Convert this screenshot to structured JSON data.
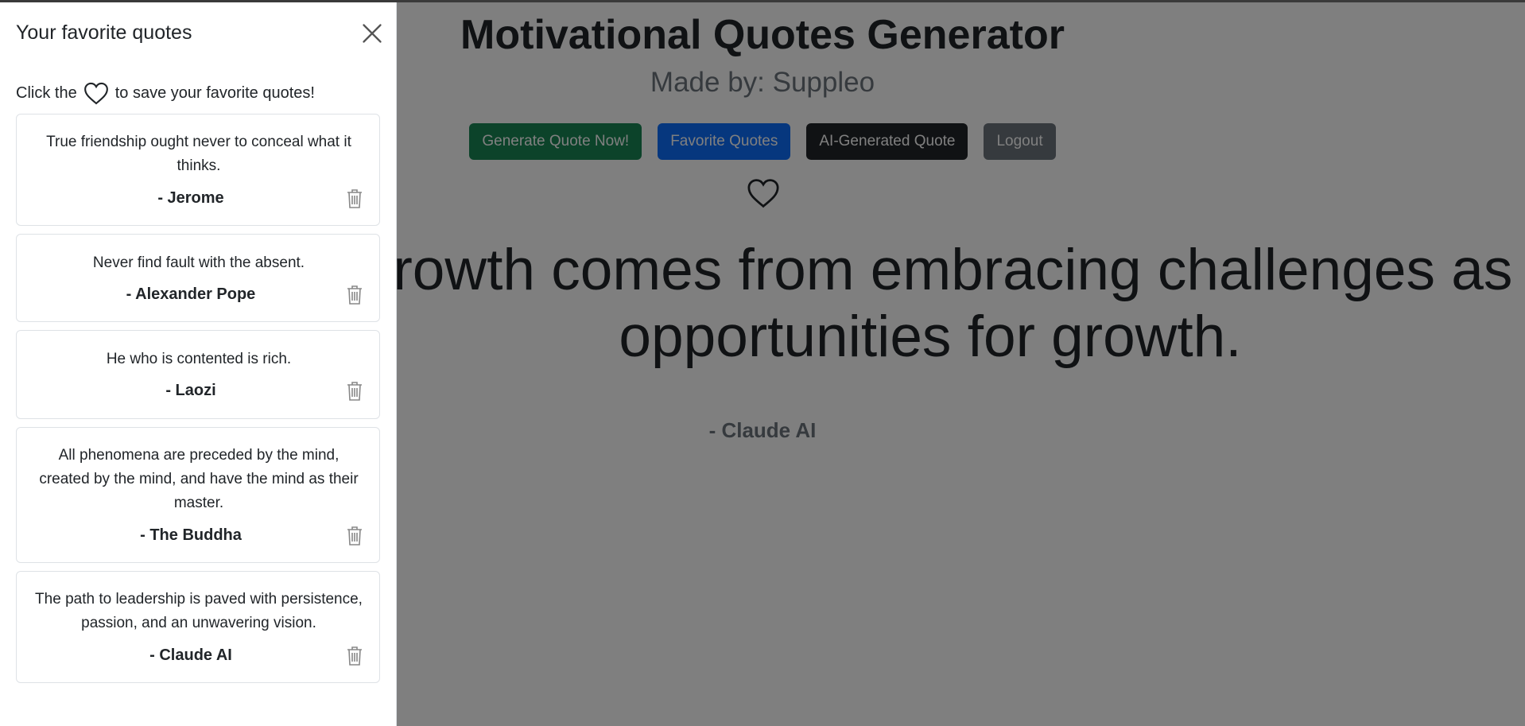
{
  "main": {
    "title": "Motivational Quotes Generator",
    "subtitle": "Made by: Suppleo",
    "buttons": {
      "generate": "Generate Quote Now!",
      "favorites": "Favorite Quotes",
      "ai": "AI-Generated Quote",
      "logout": "Logout"
    },
    "quote_line1": "Growth comes from embracing challenges as",
    "quote_line2": "opportunities for growth.",
    "quote_author": "- Claude AI"
  },
  "offcanvas": {
    "title": "Your favorite quotes",
    "hint_before": "Click the",
    "hint_after": "to save your favorite quotes!",
    "favorites": [
      {
        "text": "True friendship ought never to conceal what it thinks.",
        "author": "- Jerome"
      },
      {
        "text": "Never find fault with the absent.",
        "author": "- Alexander Pope"
      },
      {
        "text": "He who is contented is rich.",
        "author": "- Laozi"
      },
      {
        "text": "All phenomena are preceded by the mind, created by the mind, and have the mind as their master.",
        "author": "- The Buddha"
      },
      {
        "text": "The path to leadership is paved with persistence, passion, and an unwavering vision.",
        "author": "- Claude AI"
      }
    ]
  },
  "colors": {
    "green": "#198754",
    "blue": "#0d6efd",
    "dark": "#212529",
    "gray": "#6c757d",
    "backdrop": "rgba(0,0,0,0.5)"
  },
  "icons": [
    "close-icon",
    "heart-icon",
    "trash-icon"
  ]
}
